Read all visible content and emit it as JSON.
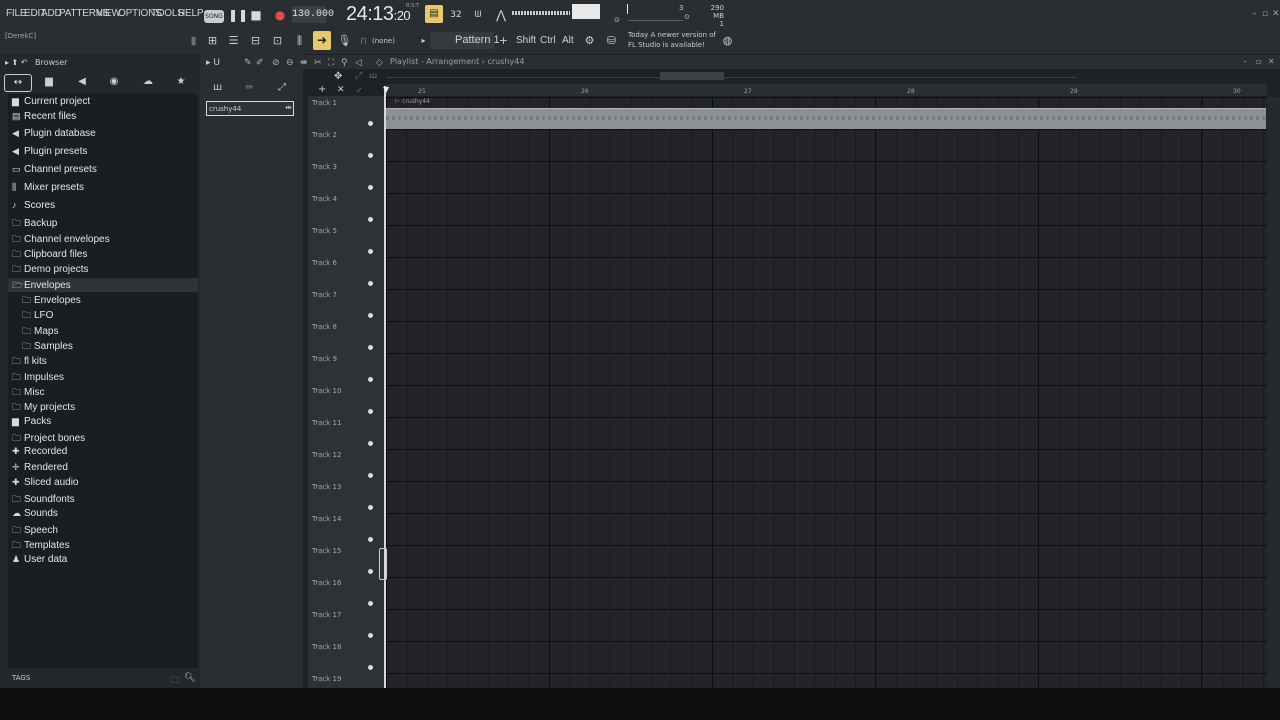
{
  "menu": [
    "FILE",
    "EDIT",
    "ADD",
    "PATTERNS",
    "VIEW",
    "OPTIONS",
    "TOOLS",
    "HELP"
  ],
  "transport": {
    "song_mode": "SONG",
    "tempo": "130.000",
    "time": "24:13",
    "time_sub": "20",
    "time_unit": "B:S:T",
    "snap_value": "3",
    "mem": "290 MB",
    "cpu_count": "1"
  },
  "toolbar2": {
    "user": "[DerekC]",
    "none_label": "(none)",
    "pattern": "Pattern 1",
    "keys": [
      "Shift",
      "Ctrl",
      "Alt"
    ],
    "news_line1": "Today A newer version of",
    "news_line2": "FL Studio is available!"
  },
  "browser": {
    "title": "Browser",
    "tree": [
      {
        "label": "Current project",
        "icon": "project-icon"
      },
      {
        "label": "Recent files",
        "icon": "recent-icon"
      },
      {
        "label": "Plugin database",
        "icon": "plugin-icon"
      },
      {
        "label": "Plugin presets",
        "icon": "plugin-icon"
      },
      {
        "label": "Channel presets",
        "icon": "channel-icon"
      },
      {
        "label": "Mixer presets",
        "icon": "mixer-icon"
      },
      {
        "label": "Scores",
        "icon": "note-icon"
      },
      {
        "label": "Backup",
        "icon": "folder-icon"
      },
      {
        "label": "Channel envelopes",
        "icon": "folder-icon"
      },
      {
        "label": "Clipboard files",
        "icon": "folder-icon"
      },
      {
        "label": "Demo projects",
        "icon": "folder-icon"
      },
      {
        "label": "Envelopes",
        "icon": "folder-icon"
      },
      {
        "label": "Envelopes",
        "icon": "folder-icon"
      },
      {
        "label": "LFO",
        "icon": "folder-icon"
      },
      {
        "label": "Maps",
        "icon": "folder-icon"
      },
      {
        "label": "Samples",
        "icon": "folder-icon"
      },
      {
        "label": "fl kits",
        "icon": "folder-icon"
      },
      {
        "label": "Impulses",
        "icon": "folder-icon"
      },
      {
        "label": "Misc",
        "icon": "folder-icon"
      },
      {
        "label": "My projects",
        "icon": "folder-icon"
      },
      {
        "label": "Packs",
        "icon": "folder-icon"
      },
      {
        "label": "Project bones",
        "icon": "folder-icon"
      },
      {
        "label": "Recorded",
        "icon": "plus-icon"
      },
      {
        "label": "Rendered",
        "icon": "rendered-icon"
      },
      {
        "label": "Sliced audio",
        "icon": "plus-icon"
      },
      {
        "label": "Soundfonts",
        "icon": "folder-icon"
      },
      {
        "label": "Sounds",
        "icon": "cloud-icon"
      },
      {
        "label": "Speech",
        "icon": "folder-icon"
      },
      {
        "label": "Templates",
        "icon": "folder-icon"
      },
      {
        "label": "User data",
        "icon": "user-icon"
      }
    ],
    "tags": "TAGS"
  },
  "picker": {
    "input_value": "crushy44"
  },
  "playlist": {
    "breadcrumb": "Playlist - Arrangement › crushy44",
    "bar_numbers": [
      "25",
      "26",
      "27",
      "28",
      "29",
      "30"
    ],
    "clip_name": "crushy44",
    "tracks": [
      "Track 1",
      "Track 2",
      "Track 3",
      "Track 4",
      "Track 5",
      "Track 6",
      "Track 7",
      "Track 8",
      "Track 9",
      "Track 10",
      "Track 11",
      "Track 12",
      "Track 13",
      "Track 14",
      "Track 15",
      "Track 16",
      "Track 17",
      "Track 18",
      "Track 19"
    ]
  },
  "colors": {
    "accent": "#e7c86c",
    "background": "#1f2224",
    "clip": "#8e9193"
  }
}
